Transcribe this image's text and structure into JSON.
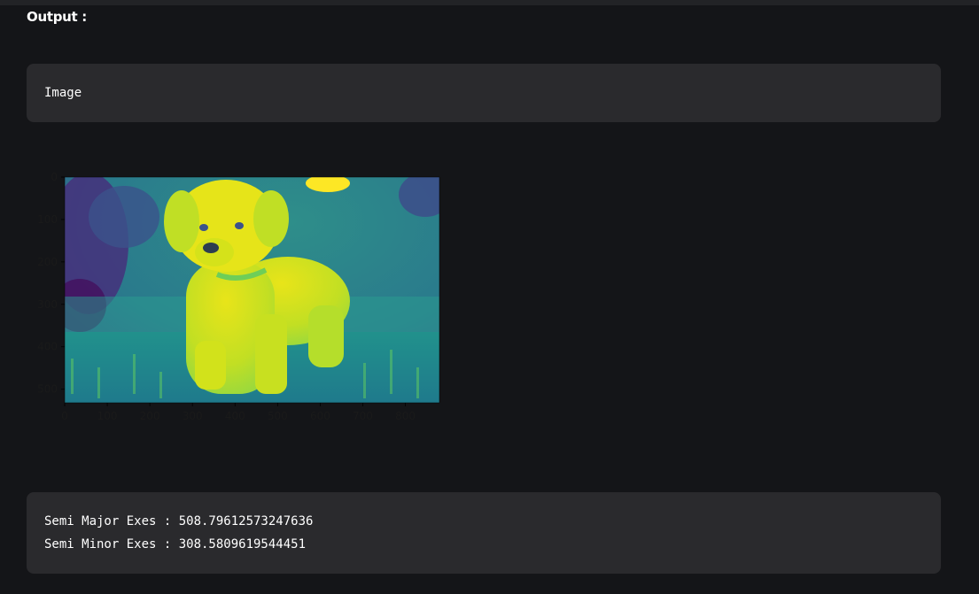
{
  "heading": "Output :",
  "image_box": {
    "label": "Image"
  },
  "plot": {
    "x_ticks": [
      "0",
      "100",
      "200",
      "300",
      "400",
      "500",
      "600",
      "700",
      "800"
    ],
    "y_ticks": [
      "0",
      "100",
      "200",
      "300",
      "400",
      "500"
    ],
    "x_range": [
      0,
      880
    ],
    "y_range": [
      0,
      532
    ],
    "colormap": "viridis",
    "subject": "puppy"
  },
  "results": {
    "major": "Semi Major Exes : 508.79612573247636",
    "minor": "Semi Minor Exes : 308.5809619544451"
  },
  "colors": {
    "background": "#141518",
    "panel": "#2a2a2d",
    "text": "#ffffff"
  }
}
